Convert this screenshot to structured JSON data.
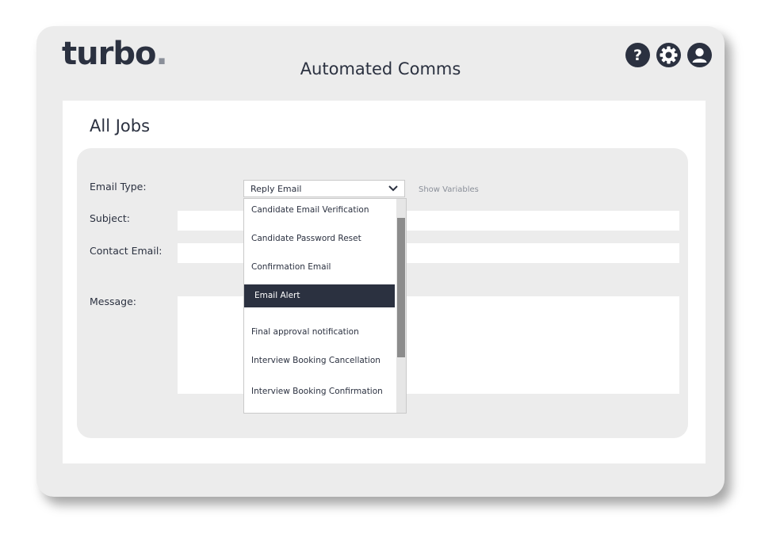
{
  "app": {
    "logo_text": "turbo",
    "logo_dot": ".",
    "title": "Automated Comms"
  },
  "header_icons": [
    {
      "name": "help-icon"
    },
    {
      "name": "settings-icon"
    },
    {
      "name": "user-icon"
    }
  ],
  "page": {
    "title": "All Jobs"
  },
  "form": {
    "email_type_label": "Email Type:",
    "subject_label": "Subject:",
    "contact_email_label": "Contact Email:",
    "message_label": "Message:",
    "email_type_value": "Reply Email",
    "show_variables": "Show Variables"
  },
  "dropdown": {
    "items": [
      "Candidate Email Verification",
      "Candidate Password Reset",
      "Confirmation Email",
      "Email Alert",
      "Final approval notification",
      "Interview Booking Cancellation",
      "Interview Booking Confirmation"
    ],
    "highlighted": "Email Alert"
  },
  "colors": {
    "primary": "#2b3140",
    "panel": "#ececec",
    "muted": "#8a8f99"
  }
}
